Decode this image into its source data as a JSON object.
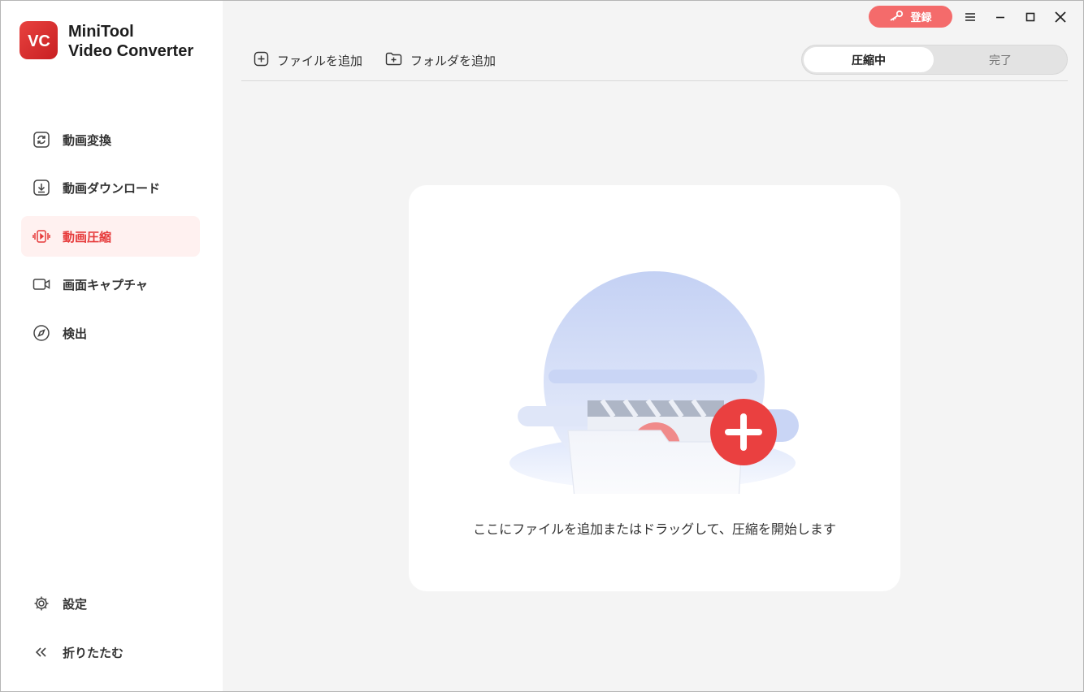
{
  "app": {
    "name_line1": "MiniTool",
    "name_line2": "Video Converter",
    "logo_letters": "VC",
    "accent_color": "#e63b3b"
  },
  "titlebar": {
    "register_label": "登録",
    "menu_icon": "hamburger-icon",
    "minimize_icon": "minimize-icon",
    "maximize_icon": "maximize-icon",
    "close_icon": "close-icon"
  },
  "sidebar": {
    "items": [
      {
        "label": "動画変換",
        "icon": "convert-icon",
        "active": false
      },
      {
        "label": "動画ダウンロード",
        "icon": "download-icon",
        "active": false
      },
      {
        "label": "動画圧縮",
        "icon": "compress-icon",
        "active": true
      },
      {
        "label": "画面キャプチャ",
        "icon": "camera-icon",
        "active": false
      },
      {
        "label": "検出",
        "icon": "compass-icon",
        "active": false
      }
    ],
    "bottom": [
      {
        "label": "設定",
        "icon": "gear-icon"
      },
      {
        "label": "折りたたむ",
        "icon": "collapse-icon"
      }
    ]
  },
  "toolbar": {
    "add_file_label": "ファイルを追加",
    "add_folder_label": "フォルダを追加",
    "tab_active": "圧縮中",
    "tab_inactive": "完了"
  },
  "dropzone": {
    "hint": "ここにファイルを追加またはドラッグして、圧縮を開始します"
  }
}
